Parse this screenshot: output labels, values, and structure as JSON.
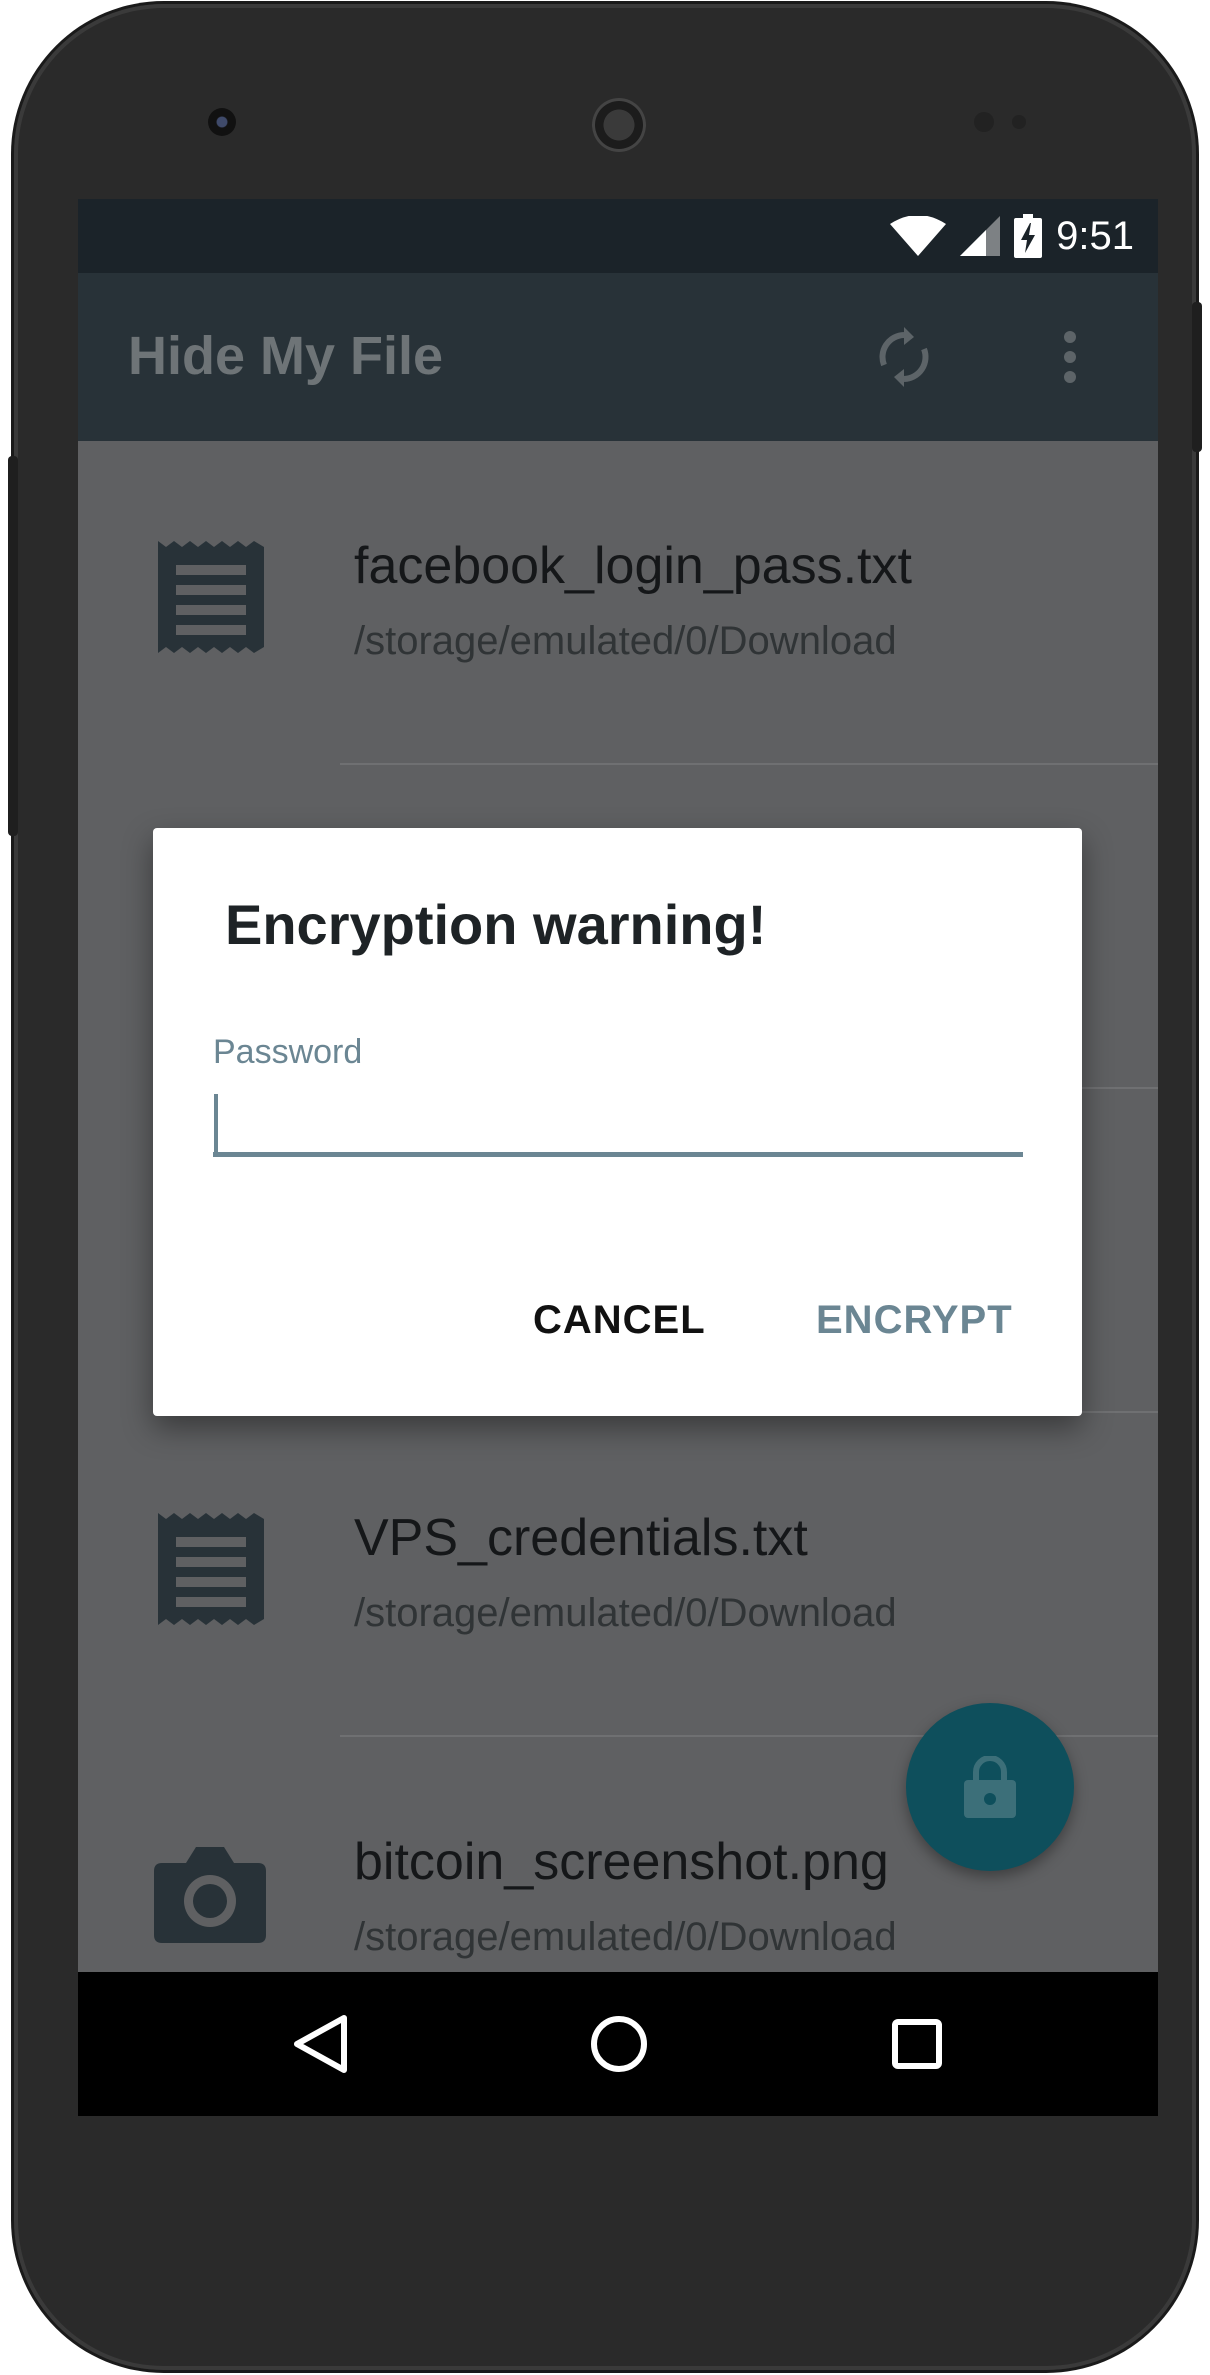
{
  "status_bar": {
    "time": "9:51",
    "icons": [
      "wifi-icon",
      "cell-signal-icon",
      "battery-charging-icon"
    ]
  },
  "app_bar": {
    "title": "Hide My File",
    "actions": [
      "sync-icon",
      "more-vert-icon"
    ]
  },
  "files": [
    {
      "name": "facebook_login_pass.txt",
      "path": "/storage/emulated/0/Download",
      "icon": "text-file-icon"
    },
    {
      "name": "",
      "path": "",
      "icon": ""
    },
    {
      "name": "",
      "path": "",
      "icon": ""
    },
    {
      "name": "VPS_credentials.txt",
      "path": "/storage/emulated/0/Download",
      "icon": "text-file-icon"
    },
    {
      "name": "bitcoin_screenshot.png",
      "path": "/storage/emulated/0/Download",
      "icon": "camera-icon"
    }
  ],
  "fab": {
    "icon": "lock-icon"
  },
  "dialog": {
    "title": "Encryption warning!",
    "password_label": "Password",
    "password_value": "",
    "cancel_label": "CANCEL",
    "encrypt_label": "ENCRYPT"
  },
  "nav_bar": {
    "buttons": [
      "back-icon",
      "home-icon",
      "recents-icon"
    ]
  },
  "colors": {
    "accent": "#6b8693",
    "app_bar": "#283238",
    "status_bar": "#1b2329",
    "fab": "#0e4f5c",
    "scrim_background": "#5f6062"
  }
}
